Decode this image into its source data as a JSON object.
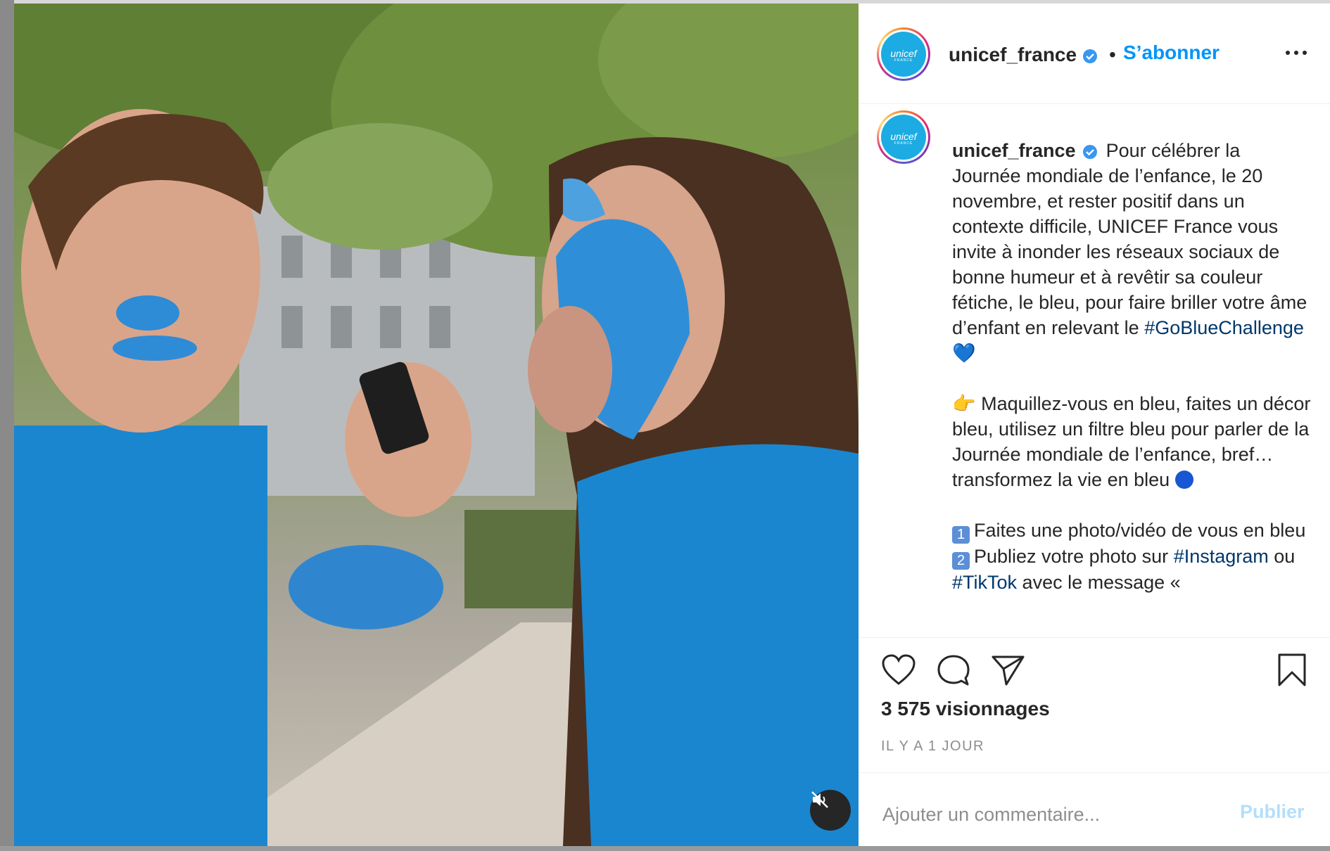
{
  "post": {
    "username": "unicef_france",
    "follow_label": "S’abonner",
    "separator": "•",
    "avatar_logo": "unicef",
    "avatar_sub": "FRANCE"
  },
  "caption": {
    "username": "unicef_france",
    "intro": "Pour célébrer la Journée mondiale de l’enfance, le 20 novembre, et rester positif dans un contexte difficile, UNICEF France vous invite à inonder les réseaux sociaux de bonne humeur et à revêtir sa couleur fétiche, le bleu, pour faire briller votre âme d’enfant en relevant le",
    "hashtag_main": "#GoBlueChallenge",
    "heart_emoji": "💙",
    "pointing_emoji": "👉",
    "para2": "Maquillez-vous en bleu, faites un décor bleu, utilisez un filtre bleu pour parler de la Journée mondiale de l’enfance, bref… transformez la vie en bleu",
    "step1_key": "1",
    "step1": "Faites une photo/vidéo de vous en bleu",
    "step2_key": "2",
    "step2_a": "Publiez votre photo sur",
    "hashtag_instagram": "#Instagram",
    "step2_b": "ou",
    "hashtag_tiktok": "#TikTok",
    "step2_c": "avec le message «"
  },
  "stats": {
    "views": "3 575 visionnages",
    "time": "IL Y A 1 JOUR"
  },
  "comment": {
    "placeholder": "Ajouter un commentaire...",
    "publish_label": "Publier"
  },
  "icons": [
    "verified-badge-icon",
    "more-options-icon",
    "heart-icon",
    "comment-icon",
    "share-icon",
    "bookmark-icon",
    "muted-speaker-icon"
  ],
  "colors": {
    "link_blue": "#0095f6",
    "hashtag_blue": "#00376b",
    "unicef_blue": "#1cabe2",
    "publish_disabled": "#b2dffc"
  }
}
